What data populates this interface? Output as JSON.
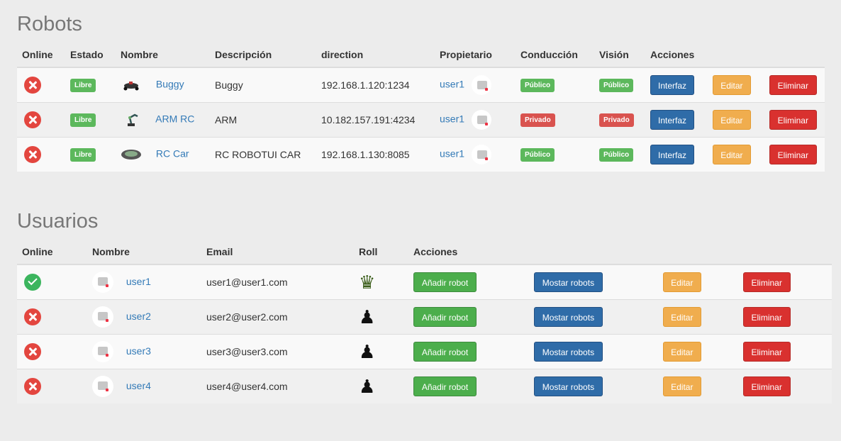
{
  "robots": {
    "title": "Robots",
    "headers": [
      "Online",
      "Estado",
      "Nombre",
      "Descripción",
      "direction",
      "Propietario",
      "Conducción",
      "Visión",
      "Acciones"
    ],
    "rows": [
      {
        "online": false,
        "estado": "Libre",
        "nombre": "Buggy",
        "descripcion": "Buggy",
        "direction": "192.168.1.120:1234",
        "propietario": "user1",
        "conduccion": "Público",
        "vision": "Público",
        "interfaz": "Interfaz",
        "editar": "Editar",
        "eliminar": "Eliminar"
      },
      {
        "online": false,
        "estado": "Libre",
        "nombre": "ARM RC",
        "descripcion": "ARM",
        "direction": "10.182.157.191:4234",
        "propietario": "user1",
        "conduccion": "Privado",
        "vision": "Privado",
        "interfaz": "Interfaz",
        "editar": "Editar",
        "eliminar": "Eliminar"
      },
      {
        "online": false,
        "estado": "Libre",
        "nombre": "RC Car",
        "descripcion": "RC ROBOTUI CAR",
        "direction": "192.168.1.130:8085",
        "propietario": "user1",
        "conduccion": "Público",
        "vision": "Público",
        "interfaz": "Interfaz",
        "editar": "Editar",
        "eliminar": "Eliminar"
      }
    ]
  },
  "usuarios": {
    "title": "Usuarios",
    "headers": [
      "Online",
      "Nombre",
      "Email",
      "Roll",
      "Acciones"
    ],
    "rows": [
      {
        "online": true,
        "nombre": "user1",
        "email": "user1@user1.com",
        "roll": "admin",
        "anadir": "Añadir robot",
        "mostrar": "Mostar robots",
        "editar": "Editar",
        "eliminar": "Eliminar"
      },
      {
        "online": false,
        "nombre": "user2",
        "email": "user2@user2.com",
        "roll": "user",
        "anadir": "Añadir robot",
        "mostrar": "Mostar robots",
        "editar": "Editar",
        "eliminar": "Eliminar"
      },
      {
        "online": false,
        "nombre": "user3",
        "email": "user3@user3.com",
        "roll": "user",
        "anadir": "Añadir robot",
        "mostrar": "Mostar robots",
        "editar": "Editar",
        "eliminar": "Eliminar"
      },
      {
        "online": false,
        "nombre": "user4",
        "email": "user4@user4.com",
        "roll": "user",
        "anadir": "Añadir robot",
        "mostrar": "Mostar robots",
        "editar": "Editar",
        "eliminar": "Eliminar"
      }
    ]
  },
  "colors": {
    "success": "#5cb85c",
    "danger": "#d9534f",
    "primary": "#2f6ca8",
    "warning": "#f0ad4e"
  }
}
